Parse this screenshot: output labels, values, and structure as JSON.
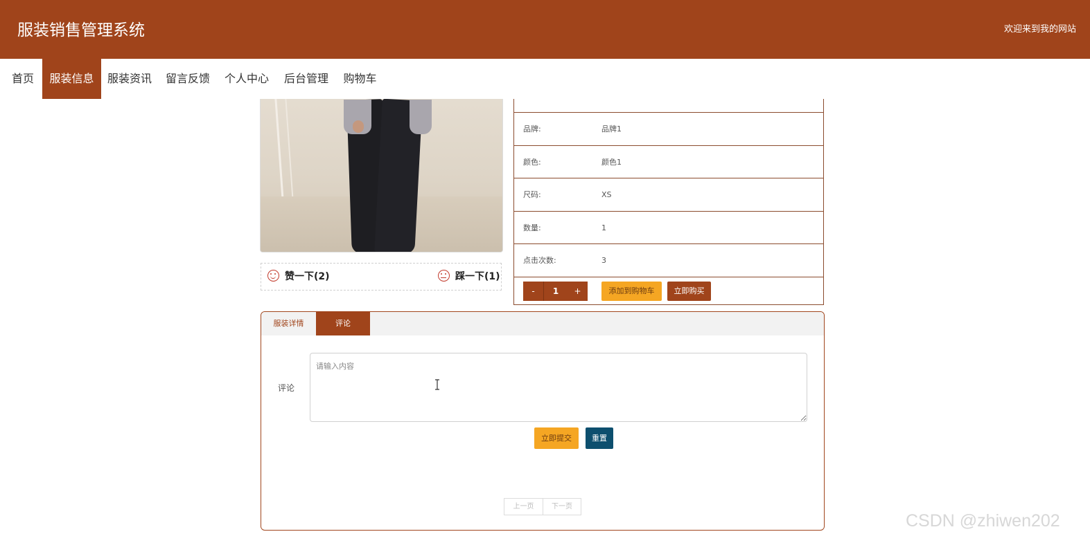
{
  "header": {
    "title": "服装销售管理系统",
    "welcome": "欢迎来到我的网站"
  },
  "nav": {
    "items": [
      {
        "label": "首页"
      },
      {
        "label": "服装信息",
        "active": true
      },
      {
        "label": "服装资讯"
      },
      {
        "label": "留言反馈"
      },
      {
        "label": "个人中心"
      },
      {
        "label": "后台管理"
      },
      {
        "label": "购物车"
      }
    ]
  },
  "product": {
    "votes": {
      "like": "赞一下(2)",
      "dislike": "踩一下(1)"
    },
    "info": [
      {
        "label": "品牌:",
        "value": "品牌1"
      },
      {
        "label": "颜色:",
        "value": "颜色1"
      },
      {
        "label": "尺码:",
        "value": "XS"
      },
      {
        "label": "数量:",
        "value": "1"
      },
      {
        "label": "点击次数:",
        "value": "3"
      }
    ],
    "quantity": {
      "minus": "-",
      "value": "1",
      "plus": "+"
    },
    "add_to_cart": "添加到购物车",
    "buy_now": "立即购买"
  },
  "tabs": [
    {
      "label": "服装详情"
    },
    {
      "label": "评论",
      "active": true
    }
  ],
  "comment": {
    "label": "评论",
    "placeholder": "请输入内容",
    "submit": "立即提交",
    "reset": "重置"
  },
  "pager": {
    "prev": "上一页",
    "next": "下一页"
  },
  "watermark": "CSDN @zhiwen202",
  "colors": {
    "brand": "#a0441b",
    "accent": "#f5a623",
    "reset_button": "#0d4f6e"
  }
}
